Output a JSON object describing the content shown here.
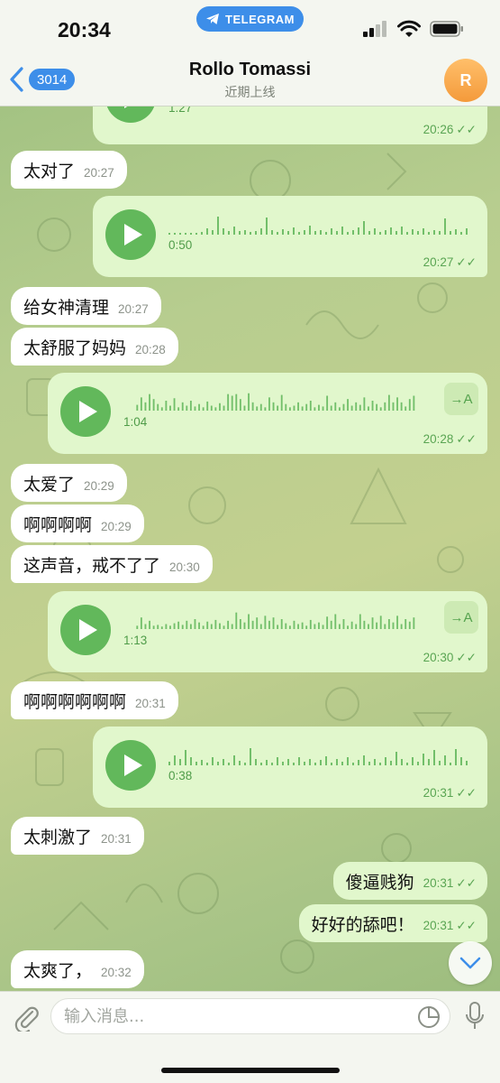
{
  "status_bar": {
    "time": "20:34",
    "app_pill": "TELEGRAM",
    "icons": [
      "cellular-icon",
      "wifi-icon",
      "battery-icon"
    ]
  },
  "header": {
    "back_count": "3014",
    "title": "Rollo Tomassi",
    "subtitle": "近期上线",
    "avatar_letter": "R"
  },
  "messages": [
    {
      "type": "voice",
      "direction": "out",
      "duration": "1:27",
      "time": "20:26",
      "partial": true
    },
    {
      "type": "text",
      "direction": "in",
      "text": "太对了",
      "time": "20:27"
    },
    {
      "type": "voice",
      "direction": "out",
      "duration": "0:50",
      "time": "20:27"
    },
    {
      "type": "text",
      "direction": "in",
      "text": "给女神清理",
      "time": "20:27"
    },
    {
      "type": "text",
      "direction": "in",
      "text": "太舒服了妈妈",
      "time": "20:28"
    },
    {
      "type": "voice",
      "direction": "out",
      "duration": "1:04",
      "time": "20:28",
      "translate": "→A"
    },
    {
      "type": "text",
      "direction": "in",
      "text": "太爱了",
      "time": "20:29"
    },
    {
      "type": "text",
      "direction": "in",
      "text": "啊啊啊啊",
      "time": "20:29"
    },
    {
      "type": "text",
      "direction": "in",
      "text": "这声音，戒不了了",
      "time": "20:30"
    },
    {
      "type": "voice",
      "direction": "out",
      "duration": "1:13",
      "time": "20:30",
      "translate": "→A"
    },
    {
      "type": "text",
      "direction": "in",
      "text": "啊啊啊啊啊啊",
      "time": "20:31"
    },
    {
      "type": "voice",
      "direction": "out",
      "duration": "0:38",
      "time": "20:31"
    },
    {
      "type": "text",
      "direction": "in",
      "text": "太刺激了",
      "time": "20:31"
    },
    {
      "type": "text",
      "direction": "out",
      "text": "傻逼贱狗",
      "time": "20:31"
    },
    {
      "type": "text",
      "direction": "out",
      "text": "好好的舔吧！",
      "time": "20:31"
    },
    {
      "type": "text",
      "direction": "in",
      "text": "太爽了，",
      "time": "20:32"
    }
  ],
  "composer": {
    "placeholder": "输入消息..."
  },
  "colors": {
    "accent": "#3d8ee9",
    "out_bubble": "#e1f7cc",
    "in_bubble": "#ffffff",
    "play_button": "#62b85b",
    "avatar": "#f49a3b"
  }
}
